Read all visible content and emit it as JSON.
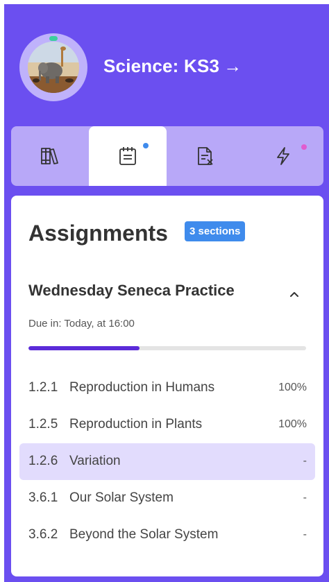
{
  "course": {
    "title": "Science: KS3",
    "arrow": "→",
    "avatar_icon": "elephant-giraffe-safari-photo"
  },
  "tabs": [
    {
      "icon": "books-icon",
      "active": false,
      "dot": null
    },
    {
      "icon": "assignments-icon",
      "active": true,
      "dot": "#3f8bec"
    },
    {
      "icon": "exam-paper-icon",
      "active": false,
      "dot": null
    },
    {
      "icon": "lightning-icon",
      "active": false,
      "dot": "#e05ccf"
    }
  ],
  "panel": {
    "title": "Assignments",
    "badge": "3 sections"
  },
  "assignment": {
    "name": "Wednesday Seneca Practice",
    "due": "Due in: Today, at 16:00",
    "progress": 0.4,
    "sections": [
      {
        "num": "1.2.1",
        "name": "Reproduction in Humans",
        "score": "100%",
        "highlight": false
      },
      {
        "num": "1.2.5",
        "name": "Reproduction in Plants",
        "score": "100%",
        "highlight": false
      },
      {
        "num": "1.2.6",
        "name": "Variation",
        "score": "-",
        "highlight": true
      },
      {
        "num": "3.6.1",
        "name": "Our Solar System",
        "score": "-",
        "highlight": false
      },
      {
        "num": "3.6.2",
        "name": "Beyond the Solar System",
        "score": "-",
        "highlight": false
      }
    ]
  },
  "colors": {
    "background": "#6b4ff0",
    "tabbar": "#b8a8f8",
    "badge": "#3f8bec",
    "progress": "#5b2bd9",
    "highlight_row": "#e2dcfd"
  }
}
